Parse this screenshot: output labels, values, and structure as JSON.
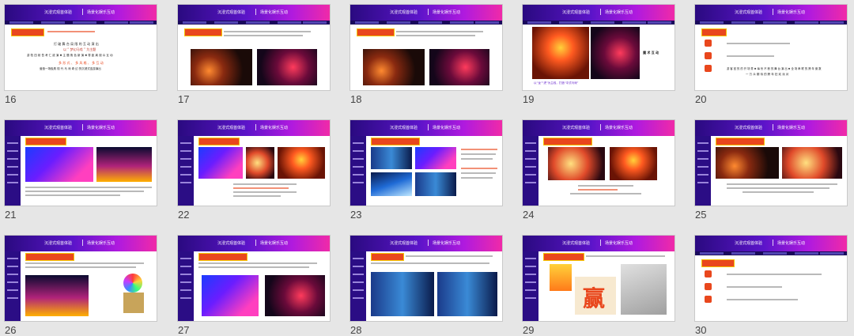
{
  "header": {
    "title_left": "沉浸式观首体验",
    "title_right": "场景化娱乐互动"
  },
  "slides": [
    {
      "num": "16"
    },
    {
      "num": "17"
    },
    {
      "num": "18"
    },
    {
      "num": "19"
    },
    {
      "num": "20"
    },
    {
      "num": "21"
    },
    {
      "num": "22"
    },
    {
      "num": "23"
    },
    {
      "num": "24"
    },
    {
      "num": "25"
    },
    {
      "num": "26"
    },
    {
      "num": "27"
    },
    {
      "num": "28"
    },
    {
      "num": "29"
    },
    {
      "num": "30"
    }
  ],
  "slide16": {
    "line1": "打 破 舞 台 局 限 的 互 动 演 出",
    "line2": "以 “ 梦幻马戏 ” 为主题",
    "line3": "游 牧 四 射 吾 考 仁 欲 演 ✖ 主 题 角 色 新 演 ✖ 零 距 离 观 众 互 动",
    "line4": "多 形 式 、 多 风 格 、 多 互 动",
    "line5": "营造一场极具 现 代 马 戏 奇 幻 的沉浸式巡游演出"
  },
  "slide19": {
    "caption": "以“龙”“虎”为主线，打造“中式马戏”",
    "side": "魔 术 互 动"
  },
  "slide20": {
    "text": "游 客 回 的 的 开 场 秀 ✖ 每 份 不 断 的 舞 台 演 出 ✖ 全 场 串 联 的 跨 年 倒 数",
    "text2": "一 万 众 期 待 的 跨 年 狂 欢 派 对"
  },
  "slide29": {
    "poster": "赢"
  }
}
